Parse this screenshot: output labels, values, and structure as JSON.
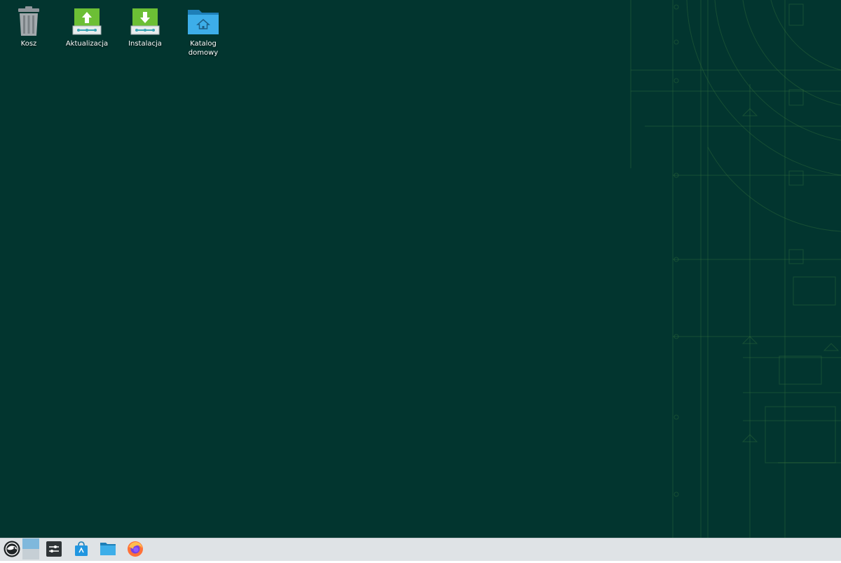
{
  "desktop": {
    "background_color": "#02352f",
    "accent_color": "#7fbf3f",
    "icons": [
      {
        "label": "Kosz",
        "icon": "trash-icon"
      },
      {
        "label": "Aktualizacja",
        "icon": "software-update-icon"
      },
      {
        "label": "Instalacja",
        "icon": "software-install-icon"
      },
      {
        "label": "Katalog domowy",
        "icon": "home-folder-icon"
      }
    ]
  },
  "taskbar": {
    "background_color": "#dfe3e6",
    "items": [
      {
        "icon": "opensuse-launcher-icon"
      },
      {
        "icon": "desktop-pager-icon"
      },
      {
        "icon": "system-settings-icon"
      },
      {
        "icon": "software-store-icon"
      },
      {
        "icon": "file-manager-icon"
      },
      {
        "icon": "firefox-icon"
      }
    ]
  }
}
